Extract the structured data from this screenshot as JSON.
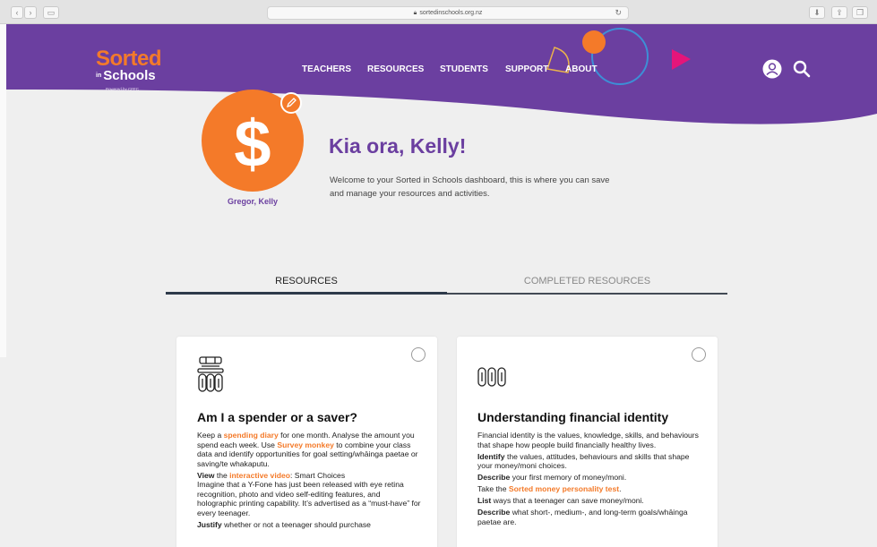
{
  "browser": {
    "url": "sortedinschools.org.nz"
  },
  "header": {
    "logo": {
      "sorted": "Sorted",
      "in": "in",
      "schools": "Schools",
      "powered": "Powered by CFFC"
    },
    "nav": [
      {
        "label": "TEACHERS"
      },
      {
        "label": "RESOURCES"
      },
      {
        "label": "STUDENTS"
      },
      {
        "label": "SUPPORT"
      },
      {
        "label": "ABOUT"
      }
    ],
    "icons": {
      "user": "user-circle-icon",
      "search": "search-icon"
    }
  },
  "colors": {
    "purple": "#6b3fa0",
    "orange": "#f47a29",
    "blue": "#3d8fd6",
    "magenta": "#e5157a",
    "yellow": "#e9b24c",
    "background": "#efefef",
    "tab_underline": "#2e3a4a"
  },
  "profile": {
    "name": "Gregor, Kelly",
    "greeting": "Kia ora, Kelly!",
    "welcome": "Welcome to your Sorted in Schools dashboard, this is where you can save and manage your resources and activities."
  },
  "tabs": [
    {
      "label": "RESOURCES",
      "active": true
    },
    {
      "label": "COMPLETED RESOURCES",
      "active": false
    }
  ],
  "cards": [
    {
      "title": "Am I a spender or a saver?",
      "icon": "coin-stack-icon",
      "p1": {
        "a": "Keep a ",
        "link1": "spending diary",
        "b": " for one month. Analyse the amount you spend each week. Use ",
        "link2": "Survey monkey",
        "c": " to combine your class data and identify opportunities for goal setting/whāinga paetae or saving/te whakaputu."
      },
      "p2": {
        "bold": "View",
        "a": " the ",
        "link": "interactive video",
        "b": ": Smart Choices"
      },
      "p3": "Imagine that a Y-Fone has just been released with eye retina recognition, photo and video self-editing features, and holographic printing capability. It’s advertised as a “must-have” for every teenager.",
      "p4": {
        "bold": "Justify",
        "a": " whether or not a teenager should purchase"
      }
    },
    {
      "title": "Understanding financial identity",
      "icon": "money-bills-icon",
      "p1": "Financial identity is the values, knowledge, skills, and behaviours that shape how people build financially healthy lives.",
      "p2": {
        "bold": "Identify",
        "a": " the values, attitudes, behaviours and skills that shape your money/moni choices."
      },
      "p3": {
        "bold": "Describe",
        "a": " your first memory of money/moni."
      },
      "p4": {
        "a": "Take the ",
        "link": "Sorted money personality test",
        "b": "."
      },
      "p5": {
        "bold": "List",
        "a": " ways that a teenager can save money/moni."
      },
      "p6": {
        "bold": "Describe",
        "a": " what short-, medium-, and long-term goals/whāinga paetae are."
      }
    }
  ]
}
